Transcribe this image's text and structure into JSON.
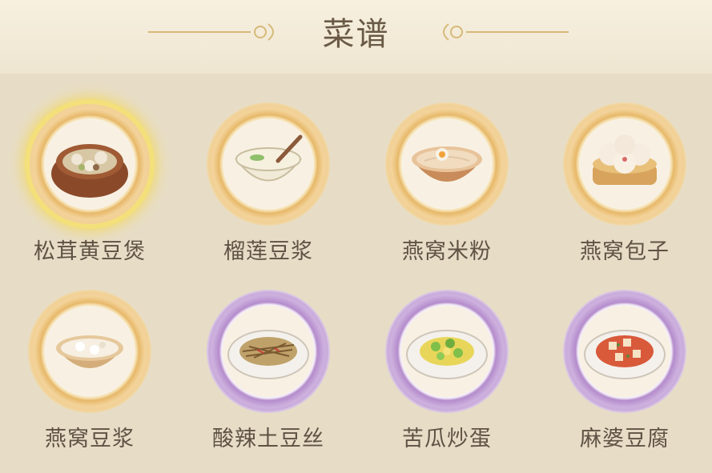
{
  "header": {
    "title": "菜谱"
  },
  "recipes": [
    {
      "name": "松茸黄豆煲",
      "icon": "mushroom-soybean-stew-icon",
      "frame": "gold",
      "selected": true
    },
    {
      "name": "榴莲豆浆",
      "icon": "durian-soymilk-icon",
      "frame": "gold"
    },
    {
      "name": "燕窝米粉",
      "icon": "birdnest-rice-noodle-icon",
      "frame": "gold"
    },
    {
      "name": "燕窝包子",
      "icon": "birdnest-bun-icon",
      "frame": "gold"
    },
    {
      "name": "燕窝豆浆",
      "icon": "birdnest-soymilk-icon",
      "frame": "gold"
    },
    {
      "name": "酸辣土豆丝",
      "icon": "hot-sour-potato-shreds-icon",
      "frame": "purple"
    },
    {
      "name": "苦瓜炒蛋",
      "icon": "bitter-melon-egg-icon",
      "frame": "purple"
    },
    {
      "name": "麻婆豆腐",
      "icon": "mapo-tofu-icon",
      "frame": "purple"
    }
  ],
  "colors": {
    "gold_frame": "#e7b869",
    "purple_frame": "#b48ccc",
    "text": "#5f5244"
  }
}
